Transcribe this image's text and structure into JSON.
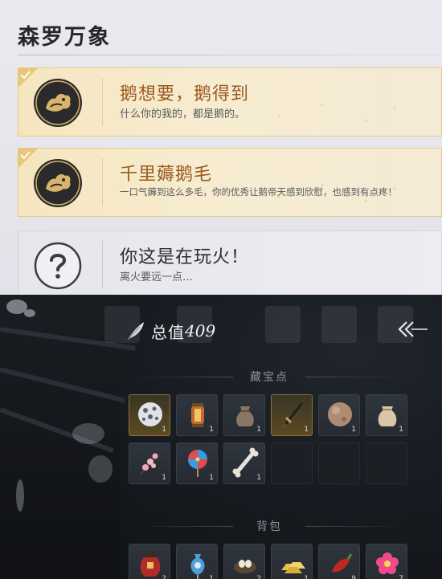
{
  "achievements": {
    "title": "森罗万象",
    "cards": [
      {
        "state": "unlocked",
        "name": "鹅想要，鹅得到",
        "desc": "什么你的我的，都是鹅的。",
        "badge_icon": "goose-emblem-icon"
      },
      {
        "state": "unlocked",
        "name": "千里薅鹅毛",
        "desc": "一口气薅到这么多毛，你的优秀让鹅帝天感到欣慰，也感到有点疼！",
        "badge_icon": "goose-emblem-icon"
      },
      {
        "state": "locked",
        "name": "你这是在玩火！",
        "desc": "离火要远一点…",
        "badge_icon": "question-mark-icon"
      }
    ]
  },
  "inventory": {
    "total_label": "总值",
    "total_value": "409",
    "total_icon": "feather-icon",
    "collapse_icon": "collapse-arrows-icon",
    "treasure_section": {
      "title": "藏宝点",
      "items": [
        {
          "icon": "spotted-ball-icon",
          "qty": "1",
          "rarity": "gold"
        },
        {
          "icon": "lantern-icon",
          "qty": "1",
          "rarity": "normal"
        },
        {
          "icon": "cloth-pouch-icon",
          "qty": "1",
          "rarity": "normal"
        },
        {
          "icon": "sword-icon",
          "qty": "1",
          "rarity": "gold"
        },
        {
          "icon": "round-stone-icon",
          "qty": "1",
          "rarity": "normal"
        },
        {
          "icon": "grain-sack-icon",
          "qty": "1",
          "rarity": "normal"
        },
        {
          "icon": "plum-blossom-branch-icon",
          "qty": "1",
          "rarity": "normal"
        },
        {
          "icon": "pinwheel-icon",
          "qty": "1",
          "rarity": "normal"
        },
        {
          "icon": "bone-icon",
          "qty": "1",
          "rarity": "normal"
        }
      ]
    },
    "bag_section": {
      "title": "背包",
      "items": [
        {
          "icon": "red-jar-icon",
          "qty": "2",
          "rarity": "normal"
        },
        {
          "icon": "blue-sachet-icon",
          "qty": "1",
          "rarity": "normal"
        },
        {
          "icon": "bird-nest-icon",
          "qty": "2",
          "rarity": "normal"
        },
        {
          "icon": "gold-ingots-icon",
          "qty": "1",
          "rarity": "normal"
        },
        {
          "icon": "red-pepper-icon",
          "qty": "9",
          "rarity": "normal"
        },
        {
          "icon": "pink-flower-icon",
          "qty": "7",
          "rarity": "normal"
        }
      ]
    }
  }
}
